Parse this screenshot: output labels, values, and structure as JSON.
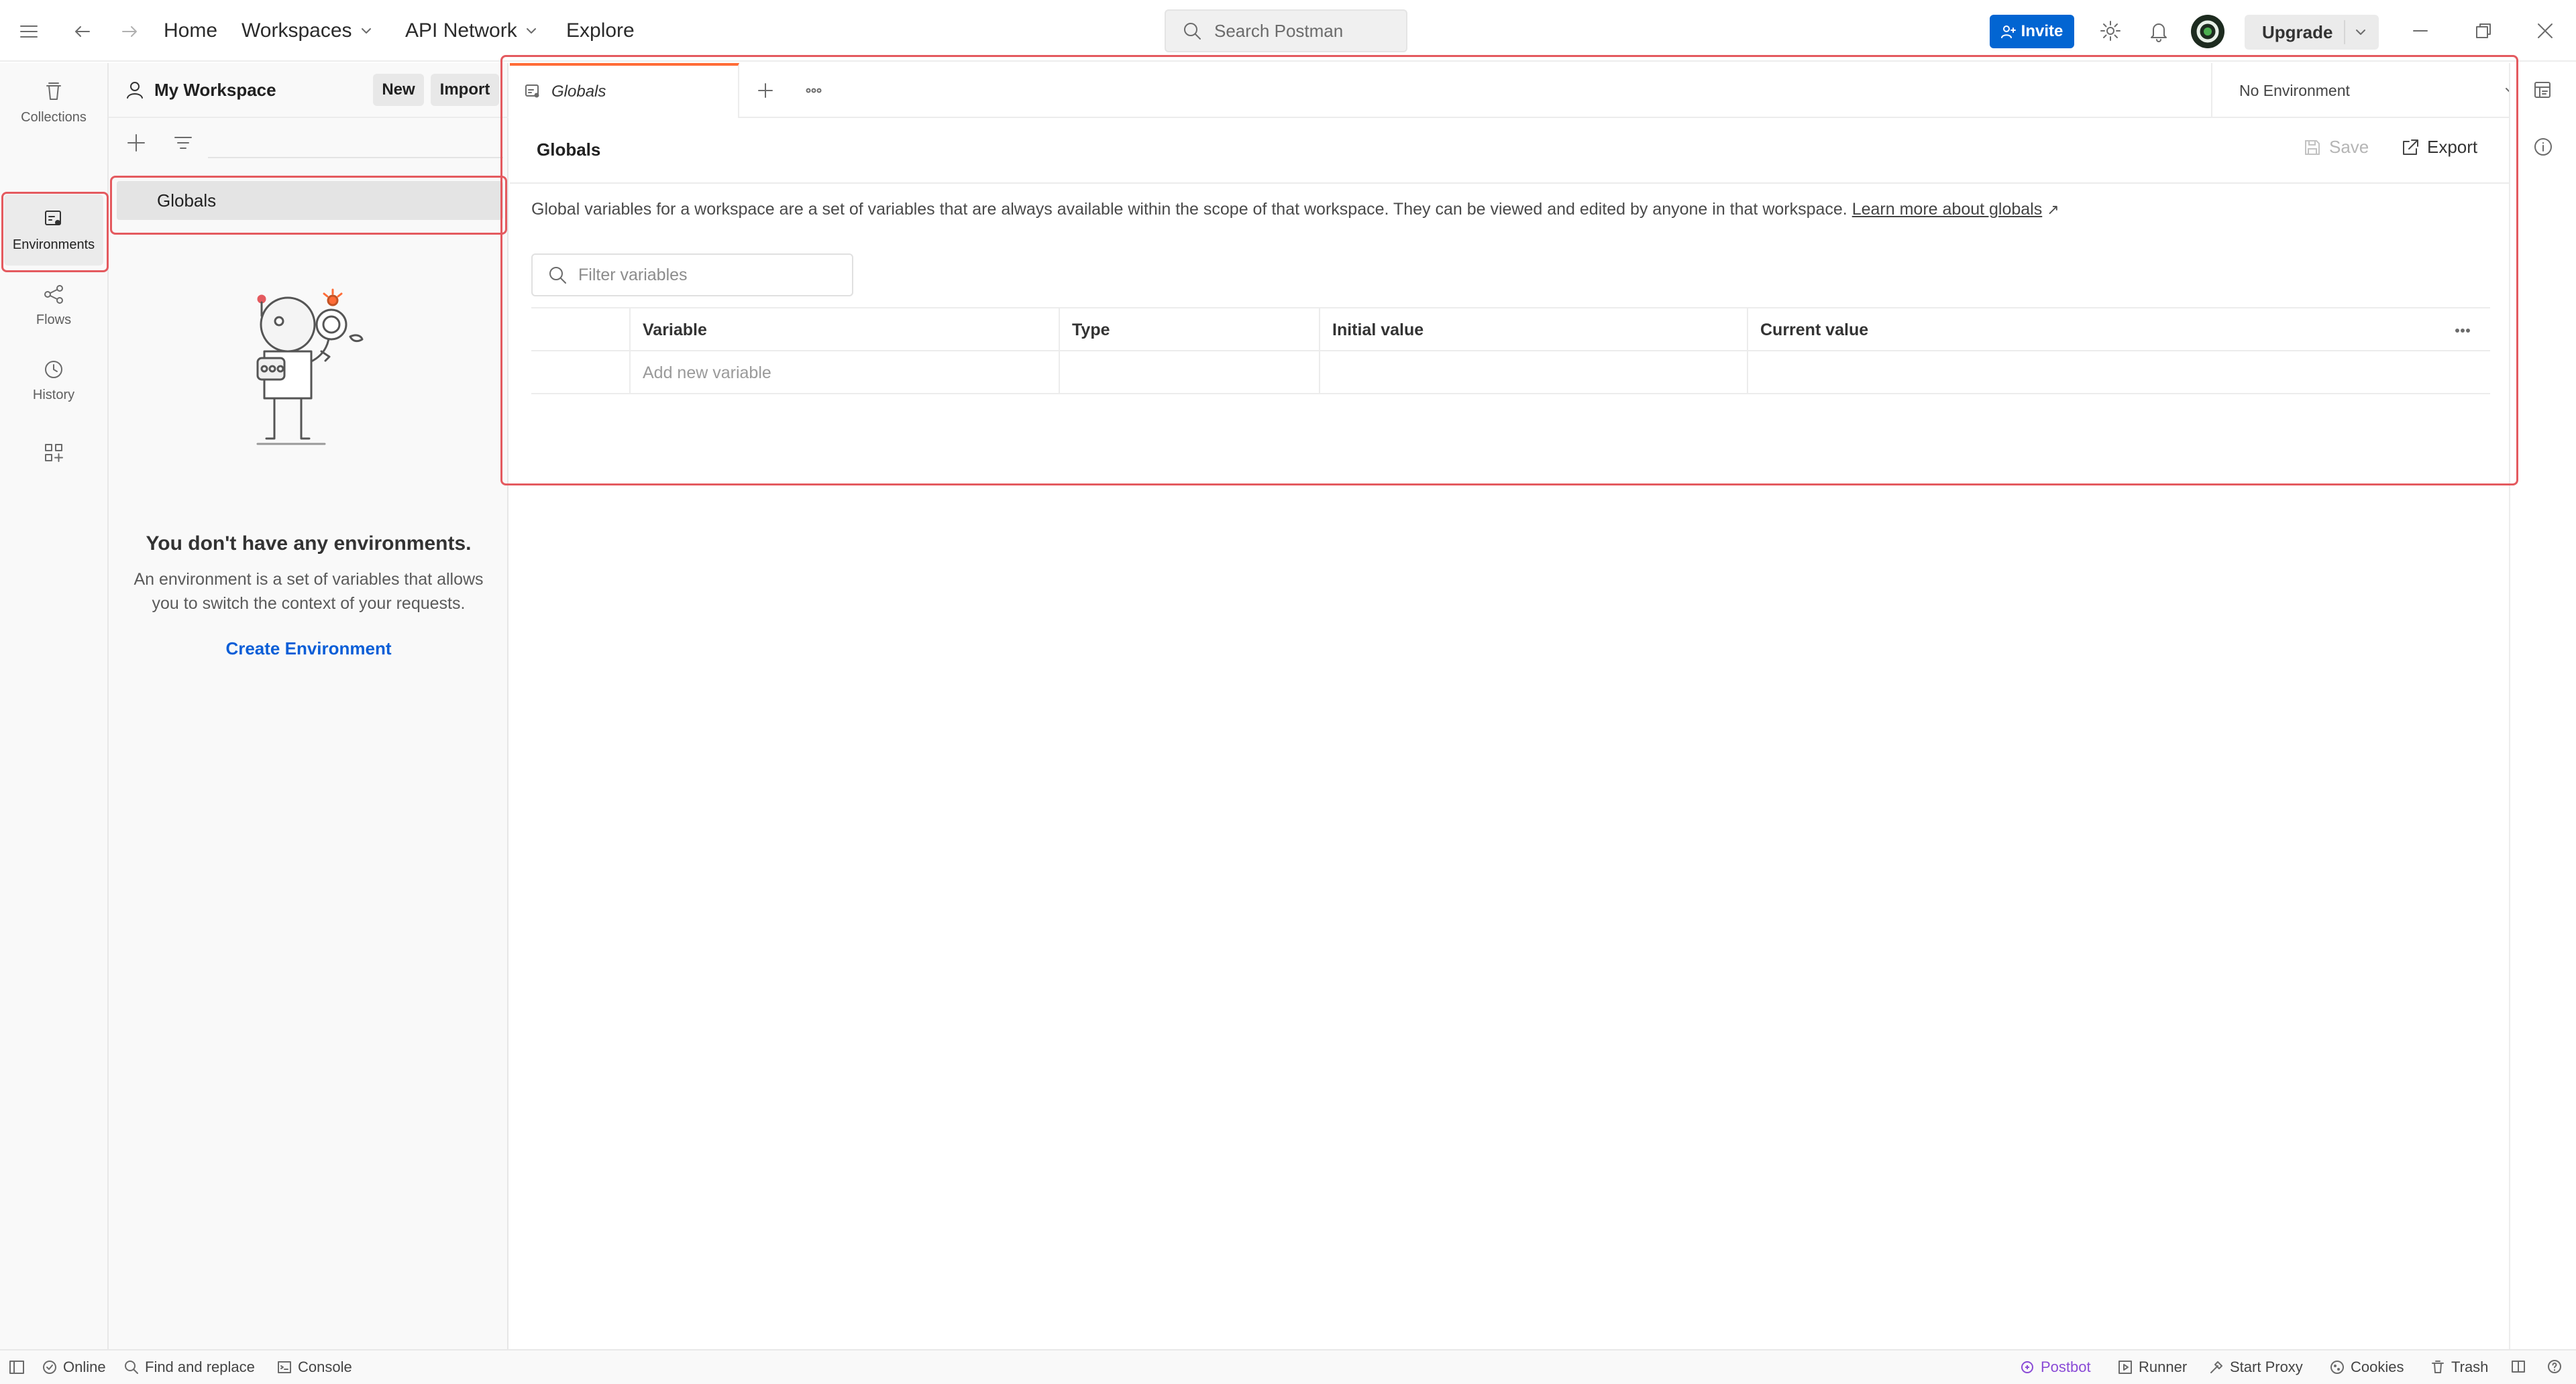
{
  "header": {
    "nav_home": "Home",
    "nav_workspaces": "Workspaces",
    "nav_api_network": "API Network",
    "nav_explore": "Explore",
    "search_placeholder": "Search Postman",
    "invite_label": "Invite",
    "upgrade_label": "Upgrade"
  },
  "rail": {
    "items": [
      {
        "label": "Collections",
        "icon": "trash-can-icon"
      },
      {
        "label": "Environments",
        "icon": "environment-icon"
      },
      {
        "label": "Flows",
        "icon": "flows-icon"
      },
      {
        "label": "History",
        "icon": "history-icon"
      }
    ]
  },
  "sidebar": {
    "workspace_name": "My Workspace",
    "new_label": "New",
    "import_label": "Import",
    "globals_label": "Globals",
    "empty_title": "You don't have any environments.",
    "empty_desc": "An environment is a set of variables that allows you to switch the context of your requests.",
    "create_env_label": "Create Environment"
  },
  "tabs": {
    "active_tab_label": "Globals",
    "environment_select": "No Environment"
  },
  "main": {
    "title": "Globals",
    "save_label": "Save",
    "export_label": "Export",
    "description": "Global variables for a workspace are a set of variables that are always available within the scope of that workspace. They can be viewed and edited by anyone in that workspace.",
    "learn_more": "Learn more about globals",
    "filter_placeholder": "Filter variables",
    "table": {
      "headers": [
        "Variable",
        "Type",
        "Initial value",
        "Current value"
      ],
      "add_row_placeholder": "Add new variable"
    }
  },
  "statusbar": {
    "online": "Online",
    "find_replace": "Find and replace",
    "console": "Console",
    "postbot": "Postbot",
    "runner": "Runner",
    "start_proxy": "Start Proxy",
    "cookies": "Cookies",
    "trash": "Trash"
  },
  "colors": {
    "accent": "#ff6c37",
    "invite": "#0265d2",
    "link": "#0b5ed7",
    "highlight": "#e45a5f",
    "postbot": "#8a4bd6"
  }
}
